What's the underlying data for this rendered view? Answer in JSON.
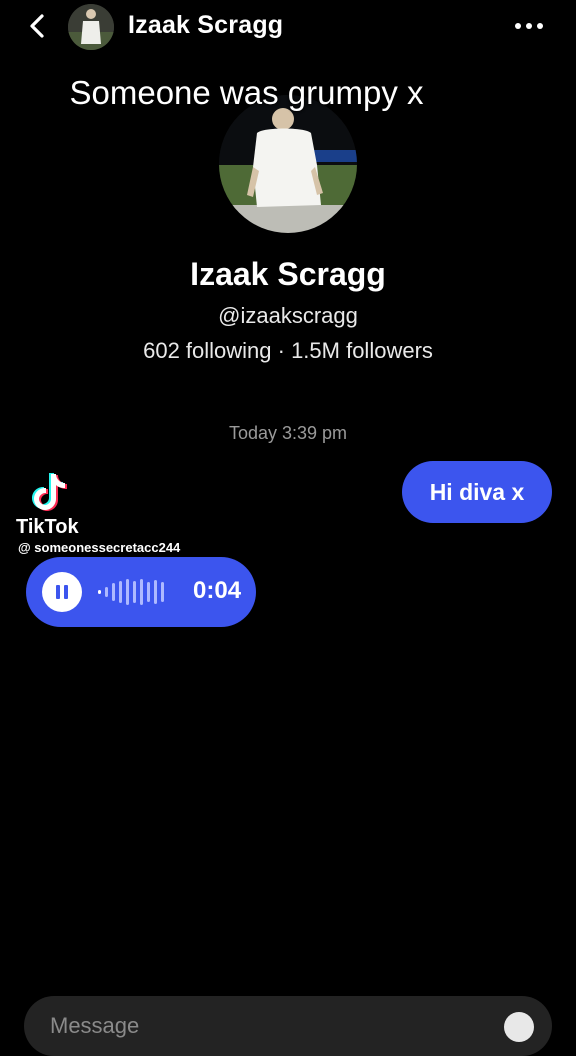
{
  "header": {
    "contact_name": "Izaak Scragg"
  },
  "overlay": {
    "caption": "Someone was grumpy x"
  },
  "profile": {
    "name": "Izaak Scragg",
    "handle": "@izaakscragg",
    "stats": "602 following · 1.5M followers"
  },
  "conversation": {
    "timestamp": "Today 3:39 pm",
    "messages": [
      {
        "direction": "outgoing",
        "type": "text",
        "text": "Hi diva x"
      },
      {
        "direction": "incoming",
        "type": "voice",
        "duration": "0:04",
        "state": "playing"
      }
    ]
  },
  "watermark": {
    "brand": "TikTok",
    "username": "@ someonessecretacc244"
  },
  "composer": {
    "placeholder": "Message"
  },
  "colors": {
    "background": "#000000",
    "bubble": "#3c55ee",
    "muted_text": "#9a9a9a"
  },
  "icons": [
    "back-chevron-icon",
    "more-dots-icon",
    "pause-icon",
    "waveform-icon",
    "tiktok-logo-icon",
    "emoji-icon"
  ]
}
